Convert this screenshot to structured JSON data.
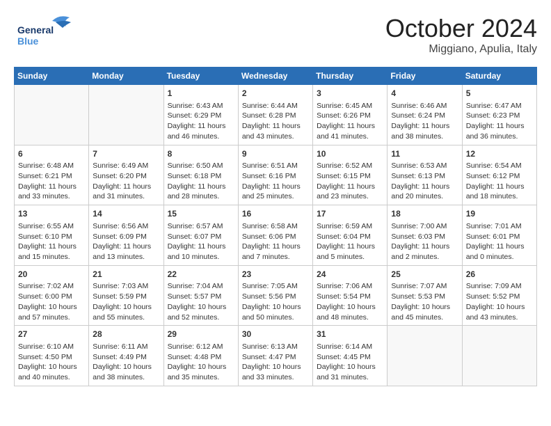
{
  "header": {
    "logo_line1": "General",
    "logo_line2": "Blue",
    "month": "October 2024",
    "location": "Miggiano, Apulia, Italy"
  },
  "weekdays": [
    "Sunday",
    "Monday",
    "Tuesday",
    "Wednesday",
    "Thursday",
    "Friday",
    "Saturday"
  ],
  "weeks": [
    [
      {
        "day": "",
        "info": ""
      },
      {
        "day": "",
        "info": ""
      },
      {
        "day": "1",
        "info": "Sunrise: 6:43 AM\nSunset: 6:29 PM\nDaylight: 11 hours\nand 46 minutes."
      },
      {
        "day": "2",
        "info": "Sunrise: 6:44 AM\nSunset: 6:28 PM\nDaylight: 11 hours\nand 43 minutes."
      },
      {
        "day": "3",
        "info": "Sunrise: 6:45 AM\nSunset: 6:26 PM\nDaylight: 11 hours\nand 41 minutes."
      },
      {
        "day": "4",
        "info": "Sunrise: 6:46 AM\nSunset: 6:24 PM\nDaylight: 11 hours\nand 38 minutes."
      },
      {
        "day": "5",
        "info": "Sunrise: 6:47 AM\nSunset: 6:23 PM\nDaylight: 11 hours\nand 36 minutes."
      }
    ],
    [
      {
        "day": "6",
        "info": "Sunrise: 6:48 AM\nSunset: 6:21 PM\nDaylight: 11 hours\nand 33 minutes."
      },
      {
        "day": "7",
        "info": "Sunrise: 6:49 AM\nSunset: 6:20 PM\nDaylight: 11 hours\nand 31 minutes."
      },
      {
        "day": "8",
        "info": "Sunrise: 6:50 AM\nSunset: 6:18 PM\nDaylight: 11 hours\nand 28 minutes."
      },
      {
        "day": "9",
        "info": "Sunrise: 6:51 AM\nSunset: 6:16 PM\nDaylight: 11 hours\nand 25 minutes."
      },
      {
        "day": "10",
        "info": "Sunrise: 6:52 AM\nSunset: 6:15 PM\nDaylight: 11 hours\nand 23 minutes."
      },
      {
        "day": "11",
        "info": "Sunrise: 6:53 AM\nSunset: 6:13 PM\nDaylight: 11 hours\nand 20 minutes."
      },
      {
        "day": "12",
        "info": "Sunrise: 6:54 AM\nSunset: 6:12 PM\nDaylight: 11 hours\nand 18 minutes."
      }
    ],
    [
      {
        "day": "13",
        "info": "Sunrise: 6:55 AM\nSunset: 6:10 PM\nDaylight: 11 hours\nand 15 minutes."
      },
      {
        "day": "14",
        "info": "Sunrise: 6:56 AM\nSunset: 6:09 PM\nDaylight: 11 hours\nand 13 minutes."
      },
      {
        "day": "15",
        "info": "Sunrise: 6:57 AM\nSunset: 6:07 PM\nDaylight: 11 hours\nand 10 minutes."
      },
      {
        "day": "16",
        "info": "Sunrise: 6:58 AM\nSunset: 6:06 PM\nDaylight: 11 hours\nand 7 minutes."
      },
      {
        "day": "17",
        "info": "Sunrise: 6:59 AM\nSunset: 6:04 PM\nDaylight: 11 hours\nand 5 minutes."
      },
      {
        "day": "18",
        "info": "Sunrise: 7:00 AM\nSunset: 6:03 PM\nDaylight: 11 hours\nand 2 minutes."
      },
      {
        "day": "19",
        "info": "Sunrise: 7:01 AM\nSunset: 6:01 PM\nDaylight: 11 hours\nand 0 minutes."
      }
    ],
    [
      {
        "day": "20",
        "info": "Sunrise: 7:02 AM\nSunset: 6:00 PM\nDaylight: 10 hours\nand 57 minutes."
      },
      {
        "day": "21",
        "info": "Sunrise: 7:03 AM\nSunset: 5:59 PM\nDaylight: 10 hours\nand 55 minutes."
      },
      {
        "day": "22",
        "info": "Sunrise: 7:04 AM\nSunset: 5:57 PM\nDaylight: 10 hours\nand 52 minutes."
      },
      {
        "day": "23",
        "info": "Sunrise: 7:05 AM\nSunset: 5:56 PM\nDaylight: 10 hours\nand 50 minutes."
      },
      {
        "day": "24",
        "info": "Sunrise: 7:06 AM\nSunset: 5:54 PM\nDaylight: 10 hours\nand 48 minutes."
      },
      {
        "day": "25",
        "info": "Sunrise: 7:07 AM\nSunset: 5:53 PM\nDaylight: 10 hours\nand 45 minutes."
      },
      {
        "day": "26",
        "info": "Sunrise: 7:09 AM\nSunset: 5:52 PM\nDaylight: 10 hours\nand 43 minutes."
      }
    ],
    [
      {
        "day": "27",
        "info": "Sunrise: 6:10 AM\nSunset: 4:50 PM\nDaylight: 10 hours\nand 40 minutes."
      },
      {
        "day": "28",
        "info": "Sunrise: 6:11 AM\nSunset: 4:49 PM\nDaylight: 10 hours\nand 38 minutes."
      },
      {
        "day": "29",
        "info": "Sunrise: 6:12 AM\nSunset: 4:48 PM\nDaylight: 10 hours\nand 35 minutes."
      },
      {
        "day": "30",
        "info": "Sunrise: 6:13 AM\nSunset: 4:47 PM\nDaylight: 10 hours\nand 33 minutes."
      },
      {
        "day": "31",
        "info": "Sunrise: 6:14 AM\nSunset: 4:45 PM\nDaylight: 10 hours\nand 31 minutes."
      },
      {
        "day": "",
        "info": ""
      },
      {
        "day": "",
        "info": ""
      }
    ]
  ]
}
